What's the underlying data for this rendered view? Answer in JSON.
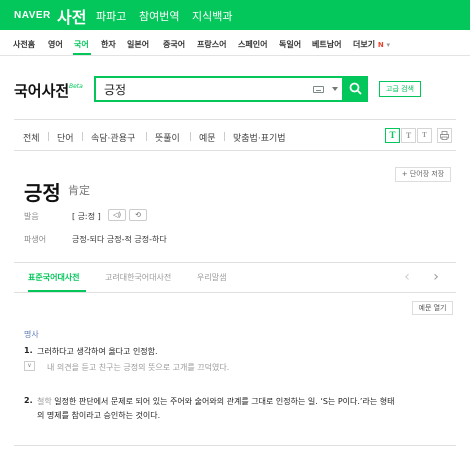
{
  "header": {
    "logo": "NAVER",
    "service": "사전",
    "nav": [
      "파파고",
      "참여번역",
      "지식백과"
    ]
  },
  "languages": {
    "items": [
      "사전홈",
      "영어",
      "국어",
      "한자",
      "일본어",
      "중국어",
      "프랑스어",
      "스페인어",
      "독일어",
      "베트남어"
    ],
    "active": "국어",
    "more_label": "더보기",
    "more_badge": "N"
  },
  "search": {
    "dict_title": "국어사전",
    "beta": "Beta",
    "query": "긍정",
    "advanced_label": "고급 검색"
  },
  "filters": {
    "tabs": [
      "전체",
      "단어",
      "속담·관용구",
      "뜻풀이",
      "예문",
      "맞춤법·표기법"
    ],
    "font_sizes": [
      "T",
      "T",
      "T"
    ],
    "print_icon": "print-icon"
  },
  "entry": {
    "word": "긍정",
    "hanja": "肯定",
    "wordbook_label": "+ 단어장 저장",
    "pronunciation_label": "발음",
    "pronunciation": "[ 긍ː정 ]",
    "derivative_label": "파생어",
    "derivatives": "긍정-되다 긍정-적 긍정-하다"
  },
  "dict_tabs": {
    "items": [
      "표준국어대사전",
      "고려대한국어대사전",
      "우리말샘"
    ],
    "active": "표준국어대사전"
  },
  "example_open_label": "예문 열기",
  "senses": {
    "pos": "명사",
    "items": [
      {
        "num": "1.",
        "definition": "그러하다고 생각하여 옳다고 인정함.",
        "example": "내 의견을 듣고 친구는 긍정의 뜻으로 고개를 끄덕였다."
      },
      {
        "num": "2.",
        "field": "철학",
        "definition_line1": "일정한 판단에서 문제로 되어 있는 주어와 술어와의 관계를 그대로 인정하는 일. ‘S는 P이다.’라는 형태",
        "definition_line2": "의 명제를 참이라고 승인하는 것이다."
      }
    ]
  }
}
